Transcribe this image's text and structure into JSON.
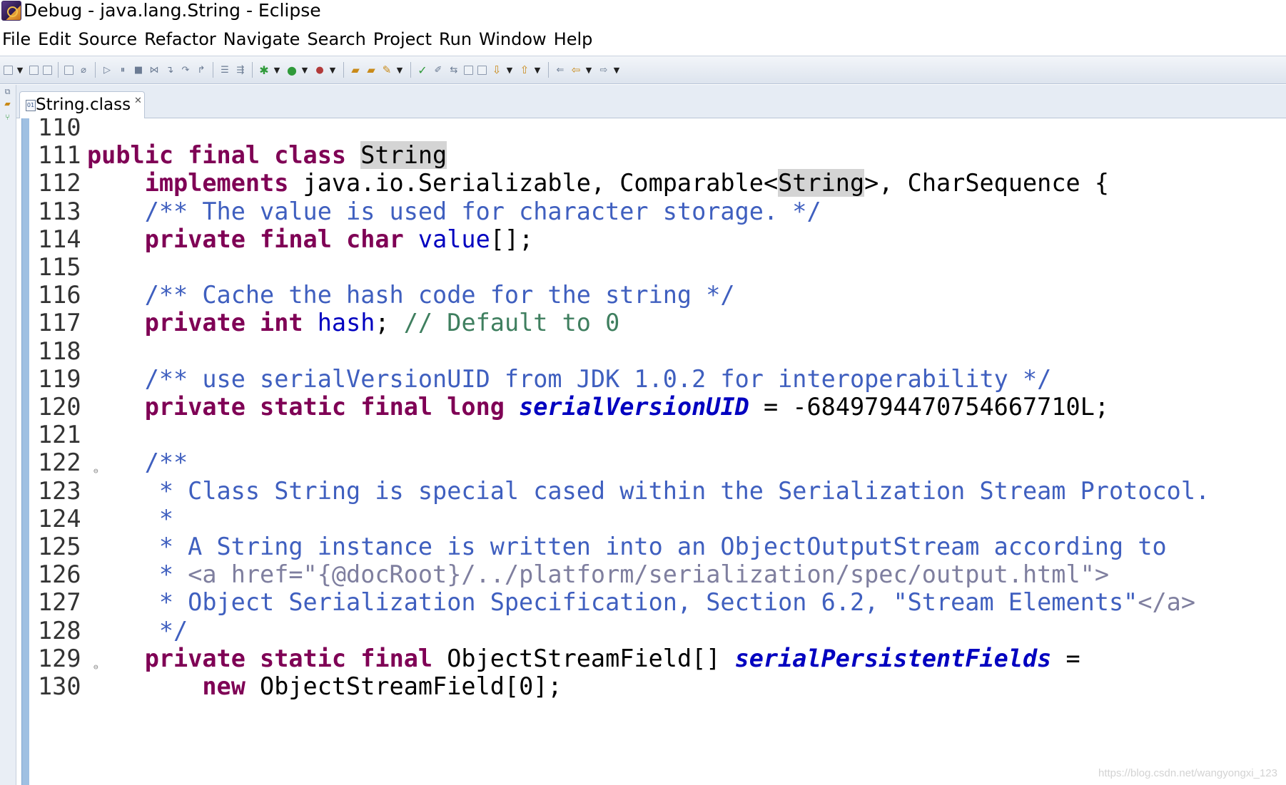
{
  "window": {
    "title": "Debug - java.lang.String - Eclipse"
  },
  "menu": [
    "File",
    "Edit",
    "Source",
    "Refactor",
    "Navigate",
    "Search",
    "Project",
    "Run",
    "Window",
    "Help"
  ],
  "editor": {
    "tab_label": "String.class",
    "lines": [
      {
        "n": "110",
        "t": [
          [
            "",
            "110"
          ]
        ]
      },
      {
        "n": "111",
        "t": [
          [
            "kw",
            "public"
          ],
          [
            "",
            " "
          ],
          [
            "kw",
            "final"
          ],
          [
            "",
            " "
          ],
          [
            "kw",
            "class"
          ],
          [
            "",
            " "
          ],
          [
            "hl",
            "String"
          ]
        ]
      },
      {
        "n": "112",
        "t": [
          [
            "",
            "    "
          ],
          [
            "kw",
            "implements"
          ],
          [
            "",
            " java.io.Serializable, Comparable<"
          ],
          [
            "hl",
            "String"
          ],
          [
            "",
            ">, CharSequence {"
          ]
        ]
      },
      {
        "n": "113",
        "t": [
          [
            "",
            "    "
          ],
          [
            "cm",
            "/** The value is used for character storage. */"
          ]
        ]
      },
      {
        "n": "114",
        "t": [
          [
            "",
            "    "
          ],
          [
            "kw",
            "private"
          ],
          [
            "",
            " "
          ],
          [
            "kw",
            "final"
          ],
          [
            "",
            " "
          ],
          [
            "kw",
            "char"
          ],
          [
            "",
            " "
          ],
          [
            "fld",
            "value"
          ],
          [
            "",
            "[];"
          ]
        ]
      },
      {
        "n": "115",
        "t": []
      },
      {
        "n": "116",
        "t": [
          [
            "",
            "    "
          ],
          [
            "cm",
            "/** Cache the hash code for the string */"
          ]
        ]
      },
      {
        "n": "117",
        "t": [
          [
            "",
            "    "
          ],
          [
            "kw",
            "private"
          ],
          [
            "",
            " "
          ],
          [
            "kw",
            "int"
          ],
          [
            "",
            " "
          ],
          [
            "fld",
            "hash"
          ],
          [
            "",
            "; "
          ],
          [
            "cmt",
            "// Default to 0"
          ]
        ]
      },
      {
        "n": "118",
        "t": []
      },
      {
        "n": "119",
        "t": [
          [
            "",
            "    "
          ],
          [
            "cm",
            "/** use serialVersionUID from JDK 1.0.2 for interoperability */"
          ]
        ]
      },
      {
        "n": "120",
        "t": [
          [
            "",
            "    "
          ],
          [
            "kw",
            "private"
          ],
          [
            "",
            " "
          ],
          [
            "kw",
            "static"
          ],
          [
            "",
            " "
          ],
          [
            "kw",
            "final"
          ],
          [
            "",
            " "
          ],
          [
            "kw",
            "long"
          ],
          [
            "",
            " "
          ],
          [
            "sfld",
            "serialVersionUID"
          ],
          [
            "",
            " = -6849794470754667710L;"
          ]
        ]
      },
      {
        "n": "121",
        "t": []
      },
      {
        "n": "122",
        "t": [
          [
            "",
            "    "
          ],
          [
            "cm",
            "/**"
          ]
        ],
        "fold": true
      },
      {
        "n": "123",
        "t": [
          [
            "",
            "     "
          ],
          [
            "cm",
            "* Class String is special cased within the Serialization Stream Protocol."
          ]
        ]
      },
      {
        "n": "124",
        "t": [
          [
            "",
            "     "
          ],
          [
            "cm",
            "*"
          ]
        ]
      },
      {
        "n": "125",
        "t": [
          [
            "",
            "     "
          ],
          [
            "cm",
            "* A String instance is written into an ObjectOutputStream according to"
          ]
        ]
      },
      {
        "n": "126",
        "t": [
          [
            "",
            "     "
          ],
          [
            "cm",
            "* "
          ],
          [
            "tag",
            "<a href=\"{@docRoot}/../platform/serialization/spec/output.html\">"
          ]
        ]
      },
      {
        "n": "127",
        "t": [
          [
            "",
            "     "
          ],
          [
            "cm",
            "* Object Serialization Specification, Section 6.2, \"Stream Elements\""
          ],
          [
            "tag",
            "</a>"
          ]
        ]
      },
      {
        "n": "128",
        "t": [
          [
            "",
            "     "
          ],
          [
            "cm",
            "*/"
          ]
        ]
      },
      {
        "n": "129",
        "t": [
          [
            "",
            "    "
          ],
          [
            "kw",
            "private"
          ],
          [
            "",
            " "
          ],
          [
            "kw",
            "static"
          ],
          [
            "",
            " "
          ],
          [
            "kw",
            "final"
          ],
          [
            "",
            " ObjectStreamField[] "
          ],
          [
            "sfld",
            "serialPersistentFields"
          ],
          [
            "",
            " ="
          ]
        ],
        "fold": true
      },
      {
        "n": "130",
        "t": [
          [
            "",
            "        "
          ],
          [
            "kw",
            "new"
          ],
          [
            "",
            " ObjectStreamField[0];"
          ]
        ]
      }
    ]
  },
  "watermark": "https://blog.csdn.net/wangyongxi_123",
  "colors": {
    "keyword": "#7f0055",
    "javadoc": "#3f5fbf",
    "line_comment": "#3f7f5f",
    "field": "#0000c0",
    "ruler": "#9fc0e2",
    "toolbar": "#dde4ee"
  }
}
